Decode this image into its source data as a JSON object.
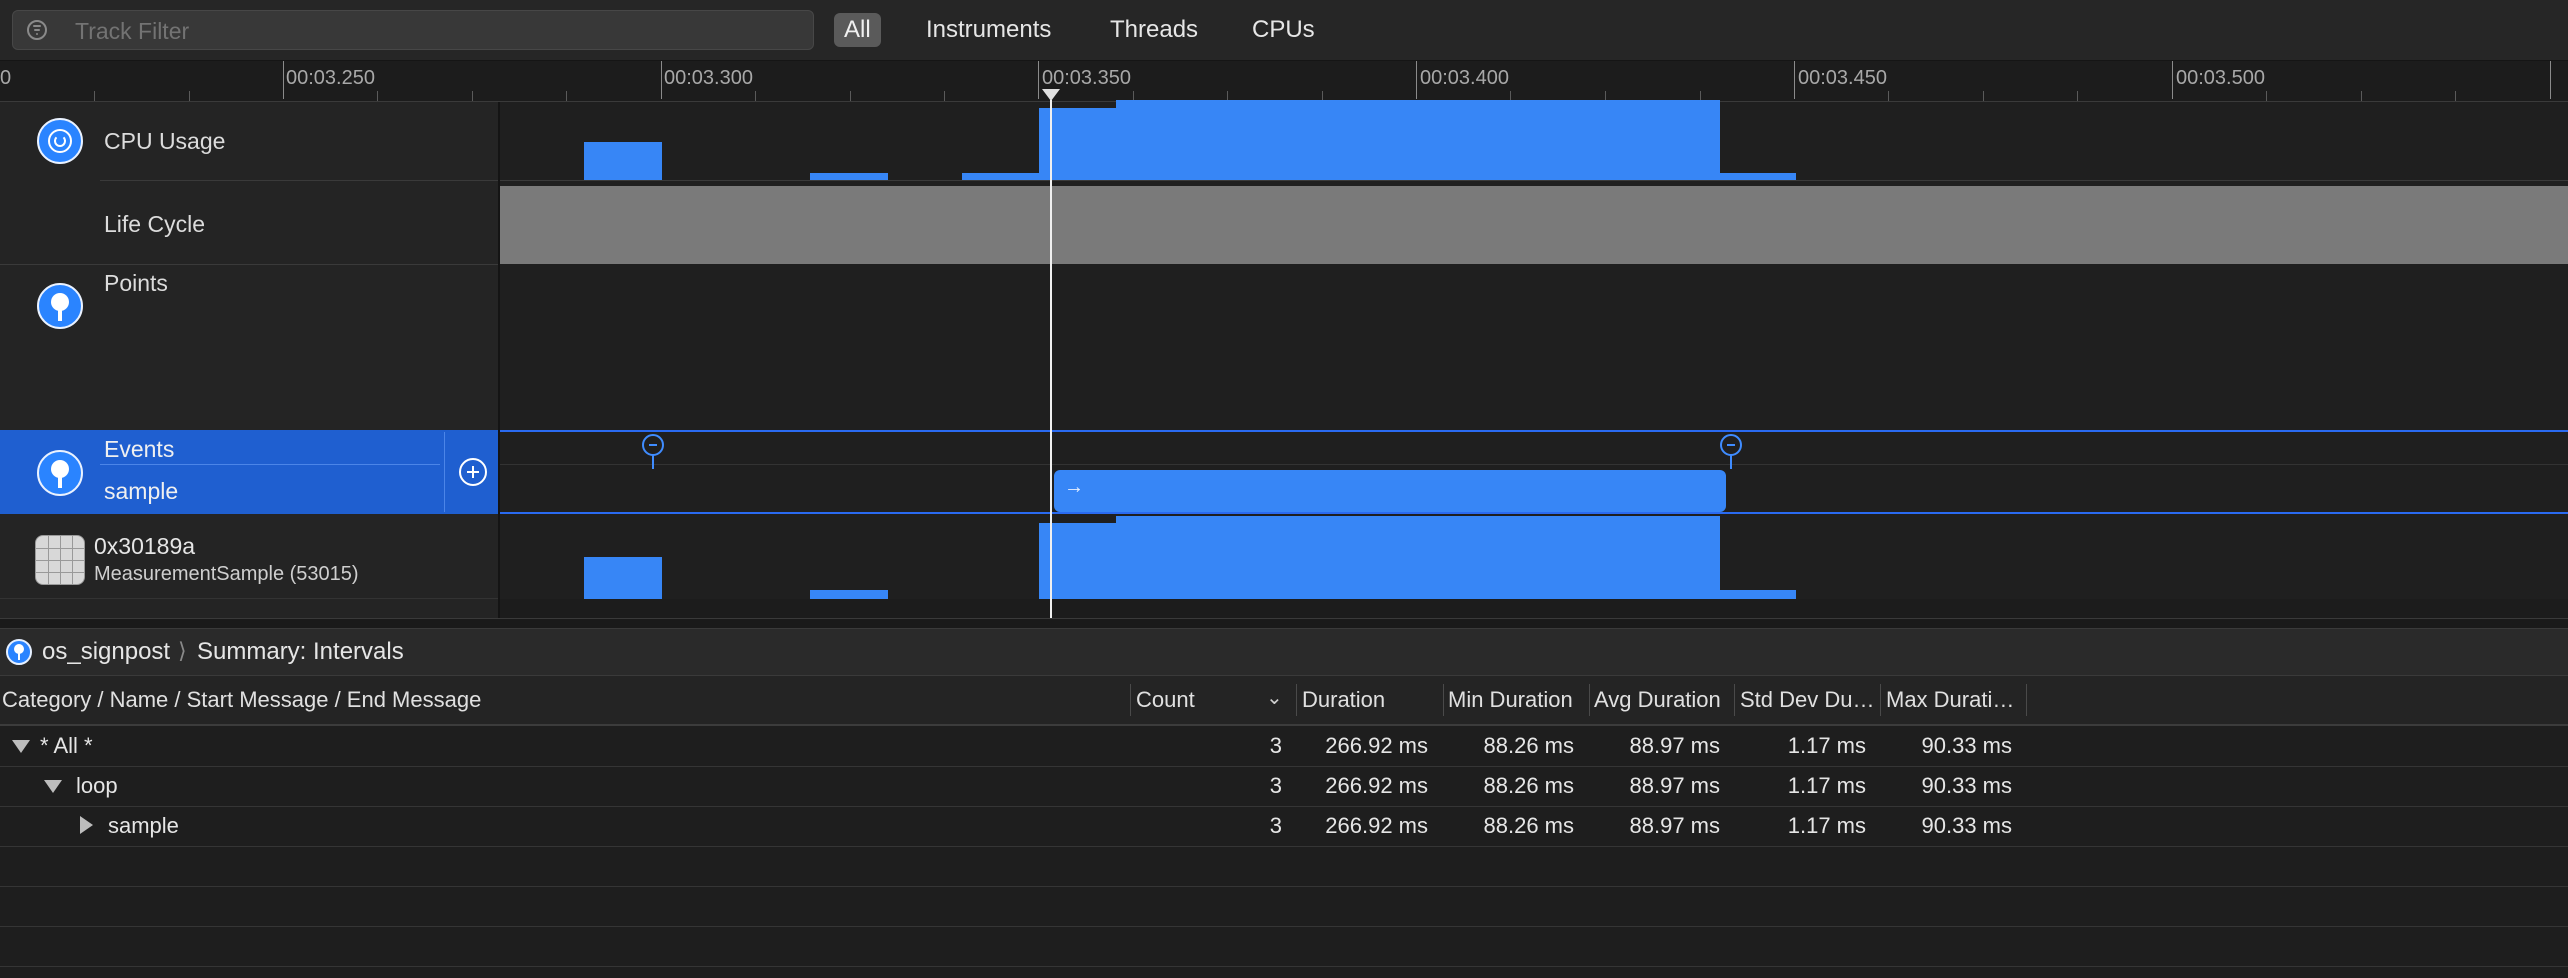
{
  "toolbar": {
    "filter_placeholder": "Track Filter",
    "tabs": [
      {
        "label": "All",
        "active": true
      },
      {
        "label": "Instruments",
        "active": false
      },
      {
        "label": "Threads",
        "active": false
      },
      {
        "label": "CPUs",
        "active": false
      }
    ]
  },
  "ruler": {
    "labels": [
      "00:03.250",
      "00:03.300",
      "00:03.350",
      "00:03.400",
      "00:03.450",
      "00:03.500"
    ],
    "leading_label": "0"
  },
  "tracks": {
    "cpu_usage": {
      "label": "CPU Usage",
      "icon": "gauge-icon"
    },
    "life_cycle": {
      "label": "Life Cycle"
    },
    "points": {
      "label": "Points",
      "icon": "pin-icon"
    },
    "events": {
      "label": "Events",
      "sublabel": "sample",
      "icon": "pin-icon",
      "add_icon": "plus-circle-icon"
    },
    "process": {
      "name": "0x30189a",
      "subtitle": "MeasurementSample (53015)",
      "icon": "process-grid-icon"
    }
  },
  "detail": {
    "breadcrumb": {
      "instrument": "os_signpost",
      "view": "Summary: Intervals"
    },
    "columns": [
      "Category / Name / Start Message / End Message",
      "Count",
      "Duration",
      "Min Duration",
      "Avg Duration",
      "Std Dev Du…",
      "Max Durati…"
    ],
    "rows": [
      {
        "name": "* All *",
        "expanded": true,
        "count": "3",
        "duration": "266.92 ms",
        "min": "88.26 ms",
        "avg": "88.97 ms",
        "std": "1.17 ms",
        "max": "90.33 ms"
      },
      {
        "name": "loop",
        "expanded": true,
        "count": "3",
        "duration": "266.92 ms",
        "min": "88.26 ms",
        "avg": "88.97 ms",
        "std": "1.17 ms",
        "max": "90.33 ms"
      },
      {
        "name": "sample",
        "expanded": false,
        "count": "3",
        "duration": "266.92 ms",
        "min": "88.26 ms",
        "avg": "88.97 ms",
        "std": "1.17 ms",
        "max": "90.33 ms"
      }
    ]
  },
  "colors": {
    "accent": "#3786f6",
    "selection": "#1f5fd0",
    "lifecycle": "#7a7a7a"
  }
}
